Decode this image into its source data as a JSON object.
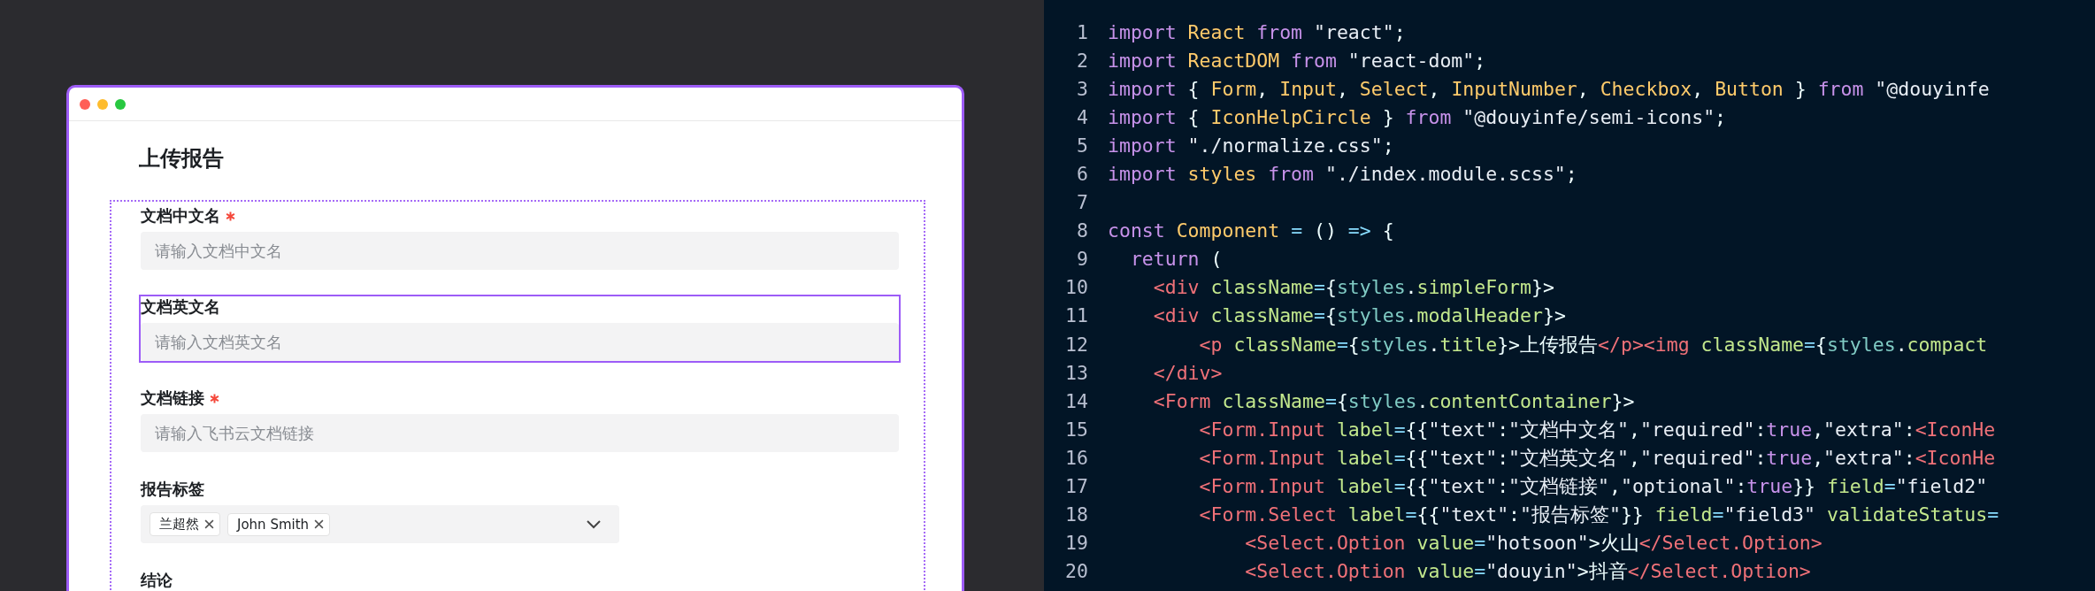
{
  "form_window": {
    "title": "上传报告",
    "fields": [
      {
        "kind": "input",
        "label": "文档中文名",
        "required": true,
        "selected": false,
        "placeholder": "请输入文档中文名"
      },
      {
        "kind": "input",
        "label": "文档英文名",
        "required": false,
        "selected": true,
        "placeholder": "请输入文档英文名"
      },
      {
        "kind": "input",
        "label": "文档链接",
        "required": true,
        "selected": false,
        "placeholder": "请输入飞书云文档链接"
      },
      {
        "kind": "select",
        "label": "报告标签",
        "required": false,
        "selected": false,
        "tags": [
          "兰超然",
          "John Smith"
        ]
      },
      {
        "kind": "label",
        "label": "结论",
        "required": false,
        "selected": false
      }
    ]
  },
  "code_editor": {
    "lines": [
      {
        "number": "1",
        "tokens": [
          {
            "kind": "kw",
            "text": "import"
          },
          {
            "kind": "name",
            "text": " React"
          },
          {
            "kind": "kw",
            "text": " from"
          },
          {
            "kind": "str",
            "text": " \"react\""
          },
          {
            "kind": "plain",
            "text": ";"
          }
        ]
      },
      {
        "number": "2",
        "tokens": [
          {
            "kind": "kw",
            "text": "import"
          },
          {
            "kind": "name",
            "text": " ReactDOM"
          },
          {
            "kind": "kw",
            "text": " from"
          },
          {
            "kind": "str",
            "text": " \"react-dom\""
          },
          {
            "kind": "plain",
            "text": ";"
          }
        ]
      },
      {
        "number": "3",
        "tokens": [
          {
            "kind": "kw",
            "text": "import"
          },
          {
            "kind": "plain",
            "text": " {"
          },
          {
            "kind": "name",
            "text": " Form"
          },
          {
            "kind": "plain",
            "text": ","
          },
          {
            "kind": "name",
            "text": " Input"
          },
          {
            "kind": "plain",
            "text": ","
          },
          {
            "kind": "name",
            "text": " Select"
          },
          {
            "kind": "plain",
            "text": ","
          },
          {
            "kind": "name",
            "text": " InputNumber"
          },
          {
            "kind": "plain",
            "text": ","
          },
          {
            "kind": "name",
            "text": " Checkbox"
          },
          {
            "kind": "plain",
            "text": ","
          },
          {
            "kind": "name",
            "text": " Button"
          },
          {
            "kind": "plain",
            "text": " }"
          },
          {
            "kind": "kw",
            "text": " from"
          },
          {
            "kind": "str",
            "text": " \"@douyinfe"
          }
        ]
      },
      {
        "number": "4",
        "tokens": [
          {
            "kind": "kw",
            "text": "import"
          },
          {
            "kind": "plain",
            "text": " {"
          },
          {
            "kind": "name",
            "text": " IconHelpCircle"
          },
          {
            "kind": "plain",
            "text": " }"
          },
          {
            "kind": "kw",
            "text": " from"
          },
          {
            "kind": "str",
            "text": " \"@douyinfe/semi-icons\""
          },
          {
            "kind": "plain",
            "text": ";"
          }
        ]
      },
      {
        "number": "5",
        "tokens": [
          {
            "kind": "kw",
            "text": "import"
          },
          {
            "kind": "str",
            "text": " \"./normalize.css\""
          },
          {
            "kind": "plain",
            "text": ";"
          }
        ]
      },
      {
        "number": "6",
        "tokens": [
          {
            "kind": "kw",
            "text": "import"
          },
          {
            "kind": "name",
            "text": " styles"
          },
          {
            "kind": "kw",
            "text": " from"
          },
          {
            "kind": "str",
            "text": " \"./index.module.scss\""
          },
          {
            "kind": "plain",
            "text": ";"
          }
        ]
      },
      {
        "number": "7"
      },
      {
        "number": "8",
        "tokens": [
          {
            "kind": "kw",
            "text": "const"
          },
          {
            "kind": "name",
            "text": " Component"
          },
          {
            "kind": "op",
            "text": " ="
          },
          {
            "kind": "plain",
            "text": " ()"
          },
          {
            "kind": "op",
            "text": " =>"
          },
          {
            "kind": "plain",
            "text": " {"
          }
        ]
      },
      {
        "number": "9",
        "tokens": [
          {
            "kind": "kw",
            "text": "  return"
          },
          {
            "kind": "plain",
            "text": " ("
          }
        ]
      },
      {
        "number": "10",
        "tokens": [
          {
            "kind": "tag",
            "text": "    <div"
          },
          {
            "kind": "attr",
            "text": " className"
          },
          {
            "kind": "op",
            "text": "="
          },
          {
            "kind": "plain",
            "text": "{"
          },
          {
            "kind": "obj",
            "text": "styles"
          },
          {
            "kind": "plain",
            "text": "."
          },
          {
            "kind": "attr",
            "text": "simpleForm"
          },
          {
            "kind": "plain",
            "text": "}>"
          }
        ]
      },
      {
        "number": "11",
        "tokens": [
          {
            "kind": "tag",
            "text": "    <div"
          },
          {
            "kind": "attr",
            "text": " className"
          },
          {
            "kind": "op",
            "text": "="
          },
          {
            "kind": "plain",
            "text": "{"
          },
          {
            "kind": "obj",
            "text": "styles"
          },
          {
            "kind": "plain",
            "text": "."
          },
          {
            "kind": "attr",
            "text": "modalHeader"
          },
          {
            "kind": "plain",
            "text": "}>"
          }
        ]
      },
      {
        "number": "12",
        "tokens": [
          {
            "kind": "tag",
            "text": "        <p"
          },
          {
            "kind": "attr",
            "text": " className"
          },
          {
            "kind": "op",
            "text": "="
          },
          {
            "kind": "plain",
            "text": "{"
          },
          {
            "kind": "obj",
            "text": "styles"
          },
          {
            "kind": "plain",
            "text": "."
          },
          {
            "kind": "attr",
            "text": "title"
          },
          {
            "kind": "plain",
            "text": "}>上传报告"
          },
          {
            "kind": "tag",
            "text": "</p><img"
          },
          {
            "kind": "attr",
            "text": " className"
          },
          {
            "kind": "op",
            "text": "="
          },
          {
            "kind": "plain",
            "text": "{"
          },
          {
            "kind": "obj",
            "text": "styles"
          },
          {
            "kind": "plain",
            "text": "."
          },
          {
            "kind": "attr",
            "text": "compact"
          }
        ]
      },
      {
        "number": "13",
        "tokens": [
          {
            "kind": "tag",
            "text": "    </div>"
          }
        ]
      },
      {
        "number": "14",
        "tokens": [
          {
            "kind": "tag",
            "text": "    <Form"
          },
          {
            "kind": "attr",
            "text": " className"
          },
          {
            "kind": "op",
            "text": "="
          },
          {
            "kind": "plain",
            "text": "{"
          },
          {
            "kind": "obj",
            "text": "styles"
          },
          {
            "kind": "plain",
            "text": "."
          },
          {
            "kind": "attr",
            "text": "contentContainer"
          },
          {
            "kind": "plain",
            "text": "}>"
          }
        ]
      },
      {
        "number": "15",
        "tokens": [
          {
            "kind": "tag",
            "text": "        <Form.Input"
          },
          {
            "kind": "attr",
            "text": " label"
          },
          {
            "kind": "op",
            "text": "="
          },
          {
            "kind": "plain",
            "text": "{{"
          },
          {
            "kind": "str",
            "text": "\"text\""
          },
          {
            "kind": "plain",
            "text": ":"
          },
          {
            "kind": "str",
            "text": "\"文档中文名\""
          },
          {
            "kind": "plain",
            "text": ","
          },
          {
            "kind": "str",
            "text": "\"required\""
          },
          {
            "kind": "plain",
            "text": ":"
          },
          {
            "kind": "kw",
            "text": "true"
          },
          {
            "kind": "plain",
            "text": ","
          },
          {
            "kind": "str",
            "text": "\"extra\""
          },
          {
            "kind": "plain",
            "text": ":"
          },
          {
            "kind": "tag",
            "text": "<IconHe"
          }
        ]
      },
      {
        "number": "16",
        "tokens": [
          {
            "kind": "tag",
            "text": "        <Form.Input"
          },
          {
            "kind": "attr",
            "text": " label"
          },
          {
            "kind": "op",
            "text": "="
          },
          {
            "kind": "plain",
            "text": "{{"
          },
          {
            "kind": "str",
            "text": "\"text\""
          },
          {
            "kind": "plain",
            "text": ":"
          },
          {
            "kind": "str",
            "text": "\"文档英文名\""
          },
          {
            "kind": "plain",
            "text": ","
          },
          {
            "kind": "str",
            "text": "\"required\""
          },
          {
            "kind": "plain",
            "text": ":"
          },
          {
            "kind": "kw",
            "text": "true"
          },
          {
            "kind": "plain",
            "text": ","
          },
          {
            "kind": "str",
            "text": "\"extra\""
          },
          {
            "kind": "plain",
            "text": ":"
          },
          {
            "kind": "tag",
            "text": "<IconHe"
          }
        ]
      },
      {
        "number": "17",
        "tokens": [
          {
            "kind": "tag",
            "text": "        <Form.Input"
          },
          {
            "kind": "attr",
            "text": " label"
          },
          {
            "kind": "op",
            "text": "="
          },
          {
            "kind": "plain",
            "text": "{{"
          },
          {
            "kind": "str",
            "text": "\"text\""
          },
          {
            "kind": "plain",
            "text": ":"
          },
          {
            "kind": "str",
            "text": "\"文档链接\""
          },
          {
            "kind": "plain",
            "text": ","
          },
          {
            "kind": "str",
            "text": "\"optional\""
          },
          {
            "kind": "plain",
            "text": ":"
          },
          {
            "kind": "kw",
            "text": "true"
          },
          {
            "kind": "plain",
            "text": "}}"
          },
          {
            "kind": "attr",
            "text": " field"
          },
          {
            "kind": "op",
            "text": "="
          },
          {
            "kind": "str",
            "text": "\"field2\""
          }
        ]
      },
      {
        "number": "18",
        "tokens": [
          {
            "kind": "tag",
            "text": "        <Form.Select"
          },
          {
            "kind": "attr",
            "text": " label"
          },
          {
            "kind": "op",
            "text": "="
          },
          {
            "kind": "plain",
            "text": "{{"
          },
          {
            "kind": "str",
            "text": "\"text\""
          },
          {
            "kind": "plain",
            "text": ":"
          },
          {
            "kind": "str",
            "text": "\"报告标签\""
          },
          {
            "kind": "plain",
            "text": "}}"
          },
          {
            "kind": "attr",
            "text": " field"
          },
          {
            "kind": "op",
            "text": "="
          },
          {
            "kind": "str",
            "text": "\"field3\""
          },
          {
            "kind": "attr",
            "text": " validateStatus"
          },
          {
            "kind": "op",
            "text": "="
          }
        ]
      },
      {
        "number": "19",
        "tokens": [
          {
            "kind": "tag",
            "text": "            <Select.Option"
          },
          {
            "kind": "attr",
            "text": " value"
          },
          {
            "kind": "op",
            "text": "="
          },
          {
            "kind": "str",
            "text": "\"hotsoon\""
          },
          {
            "kind": "plain",
            "text": ">火山"
          },
          {
            "kind": "tag",
            "text": "</Select.Option>"
          }
        ]
      },
      {
        "number": "20",
        "tokens": [
          {
            "kind": "tag",
            "text": "            <Select.Option"
          },
          {
            "kind": "attr",
            "text": " value"
          },
          {
            "kind": "op",
            "text": "="
          },
          {
            "kind": "str",
            "text": "\"douyin\""
          },
          {
            "kind": "plain",
            "text": ">抖音"
          },
          {
            "kind": "tag",
            "text": "</Select.Option>"
          }
        ]
      }
    ]
  }
}
